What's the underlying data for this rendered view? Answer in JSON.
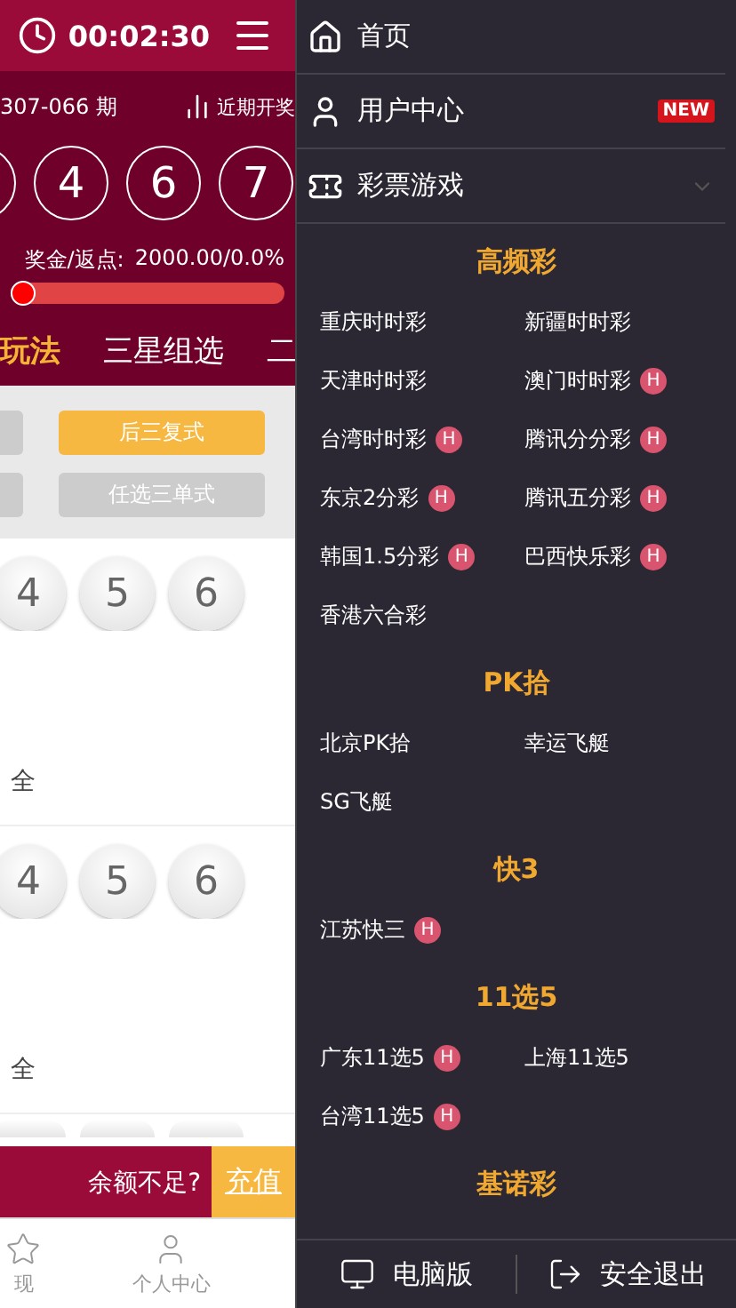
{
  "header": {
    "time": "00:02:30"
  },
  "issue": {
    "number": "307-066 期",
    "history": "近期开奖"
  },
  "balls": [
    "4",
    "6",
    "7"
  ],
  "prize": {
    "label": "奖金/返点:",
    "value": "2000.00/0.0%",
    "level": 0
  },
  "tabs": [
    {
      "label": "玩法",
      "selected": true
    },
    {
      "label": "三星组选",
      "selected": false
    },
    {
      "label": "二",
      "selected": false
    }
  ],
  "play_buttons": [
    {
      "label": "后三复式",
      "selected": true
    },
    {
      "label": "任选三单式",
      "selected": false
    }
  ],
  "digit_rows": [
    {
      "digits": [
        "4",
        "5",
        "6"
      ],
      "all": "全"
    },
    {
      "digits": [
        "4",
        "5",
        "6"
      ],
      "all": "全"
    }
  ],
  "balance_bar": {
    "text": "余额不足?",
    "link": "充值"
  },
  "bottom_nav": [
    {
      "label": "现"
    },
    {
      "label": "个人中心"
    }
  ],
  "drawer": {
    "menu": [
      {
        "label": "首页"
      },
      {
        "label": "用户中心",
        "badge": "NEW"
      },
      {
        "label": "彩票游戏",
        "expanded": true
      }
    ],
    "sections": [
      {
        "title": "高频彩",
        "items": [
          {
            "label": "重庆时时彩"
          },
          {
            "label": "新疆时时彩"
          },
          {
            "label": "天津时时彩"
          },
          {
            "label": "澳门时时彩",
            "badge": "H"
          },
          {
            "label": "台湾时时彩",
            "badge": "H"
          },
          {
            "label": "腾讯分分彩",
            "badge": "H"
          },
          {
            "label": "东京2分彩",
            "badge": "H"
          },
          {
            "label": "腾讯五分彩",
            "badge": "H"
          },
          {
            "label": "韩国1.5分彩",
            "badge": "H"
          },
          {
            "label": "巴西快乐彩",
            "badge": "H"
          },
          {
            "label": "香港六合彩"
          }
        ]
      },
      {
        "title": "PK拾",
        "items": [
          {
            "label": "北京PK拾"
          },
          {
            "label": "幸运飞艇"
          },
          {
            "label": "SG飞艇"
          }
        ]
      },
      {
        "title": "快3",
        "items": [
          {
            "label": "江苏快三",
            "badge": "H"
          }
        ]
      },
      {
        "title": "11选5",
        "items": [
          {
            "label": "广东11选5",
            "badge": "H"
          },
          {
            "label": "上海11选5"
          },
          {
            "label": "台湾11选5",
            "badge": "H"
          }
        ]
      },
      {
        "title": "基诺彩"
      }
    ],
    "footer": [
      {
        "label": "电脑版"
      },
      {
        "label": "安全退出"
      }
    ]
  }
}
